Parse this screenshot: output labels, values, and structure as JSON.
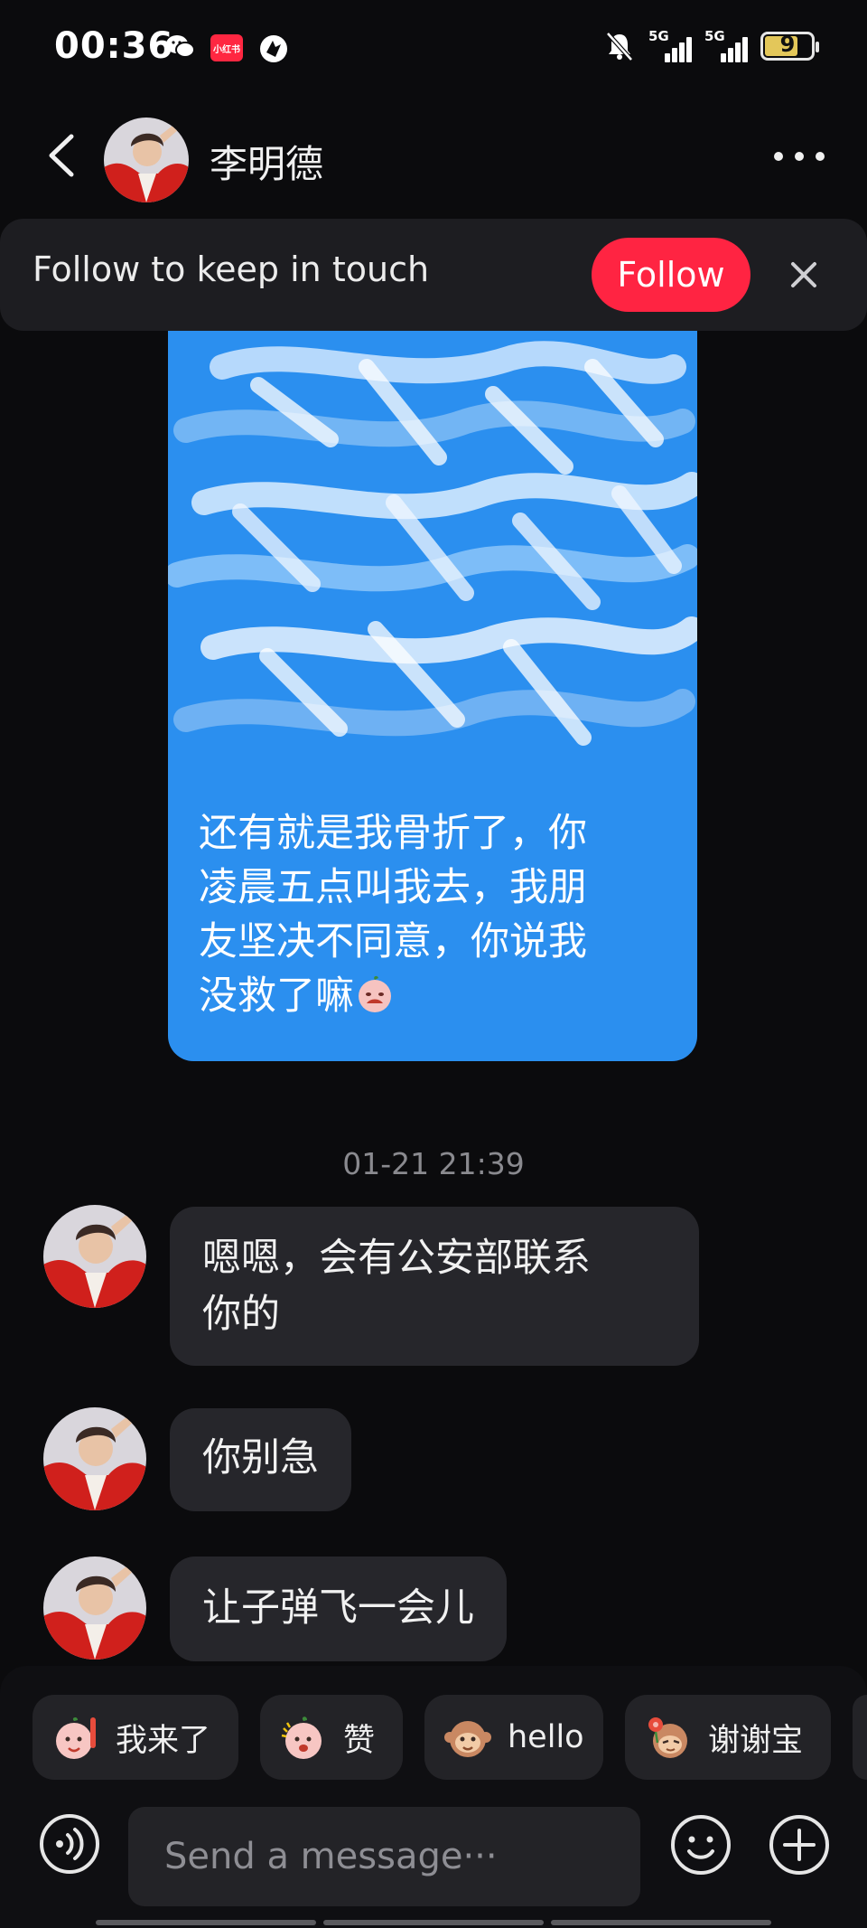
{
  "status_bar": {
    "time": "00:36",
    "redbook_badge": "小红书",
    "sim1_label": "5G",
    "sim2_label": "5G",
    "battery": "9"
  },
  "header": {
    "contact_name": "李明德"
  },
  "follow_banner": {
    "text": "Follow to keep in touch",
    "follow_label": "Follow"
  },
  "conversation": {
    "my_message_visible_lines": [
      "还有就是我骨折了，你",
      "凌晨五点叫我去，我朋",
      "友坚决不同意，你说我",
      "没救了嘛"
    ],
    "timestamp": "01-21 21:39",
    "incoming": [
      {
        "lines": [
          "嗯嗯，会有公安部联系",
          "你的"
        ]
      },
      {
        "lines": [
          "你别急"
        ]
      },
      {
        "lines": [
          "让子弹飞一会儿"
        ]
      }
    ]
  },
  "quick_replies": [
    {
      "label": "我来了",
      "icon": "sticker-wave-icon"
    },
    {
      "label": "赞",
      "icon": "sticker-thumbs-icon"
    },
    {
      "label": "hello",
      "icon": "sticker-monkey-icon"
    },
    {
      "label": "谢谢宝",
      "icon": "sticker-thanks-icon"
    }
  ],
  "input": {
    "placeholder": "Send a message···"
  },
  "colors": {
    "accent": "#ff2442",
    "my_bubble": "#2b8fef",
    "incoming_bubble": "#26262b",
    "background": "#0b0b0d"
  }
}
